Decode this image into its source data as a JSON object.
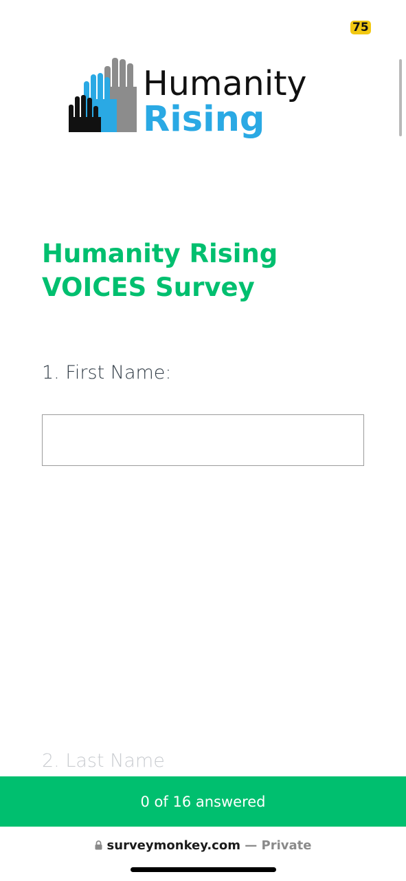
{
  "status": {
    "badge_count": "75"
  },
  "logo": {
    "line1": "Humanity",
    "line2": "Rising"
  },
  "survey": {
    "title": "Humanity Rising VOICES Survey"
  },
  "questions": [
    {
      "label": "1. First Name:",
      "value": ""
    },
    {
      "label": "2. Last Name"
    }
  ],
  "progress": {
    "text": "0 of 16 answered"
  },
  "browser": {
    "domain": "surveymonkey.com",
    "suffix": " — Private"
  },
  "colors": {
    "accent": "#00bf6f",
    "logo_blue": "#2aa9e4",
    "badge": "#f2c811"
  }
}
